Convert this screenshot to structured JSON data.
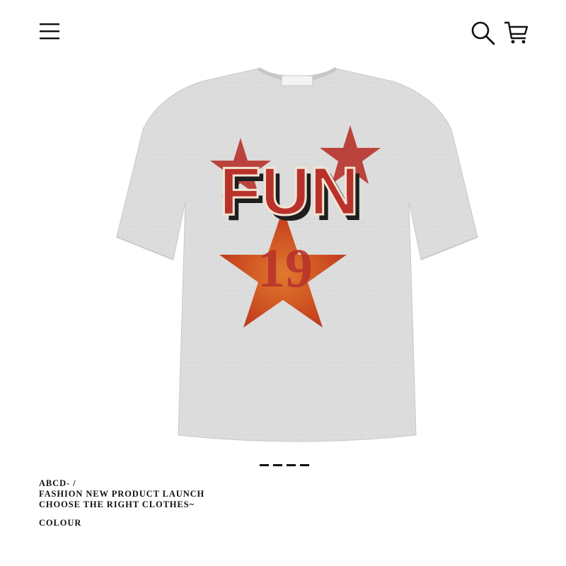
{
  "header": {
    "menu_icon": "hamburger-menu-icon",
    "search_icon": "search-icon",
    "cart_icon": "shopping-cart-icon"
  },
  "product": {
    "image_icon": "tshirt-product-image",
    "graphic_word": "FUN",
    "graphic_number": "19",
    "shirt_color": "#dcdcdc",
    "graphic_red": "#b8322b",
    "star_orange": "#d9682f"
  },
  "carousel": {
    "dot_count": 4
  },
  "caption": {
    "line1": "ABCD- /",
    "line2": "FASHION NEW PRODUCT LAUNCH",
    "line3": "CHOOSE THE RIGHT CLOTHES~"
  },
  "colour_label": "COLOUR"
}
